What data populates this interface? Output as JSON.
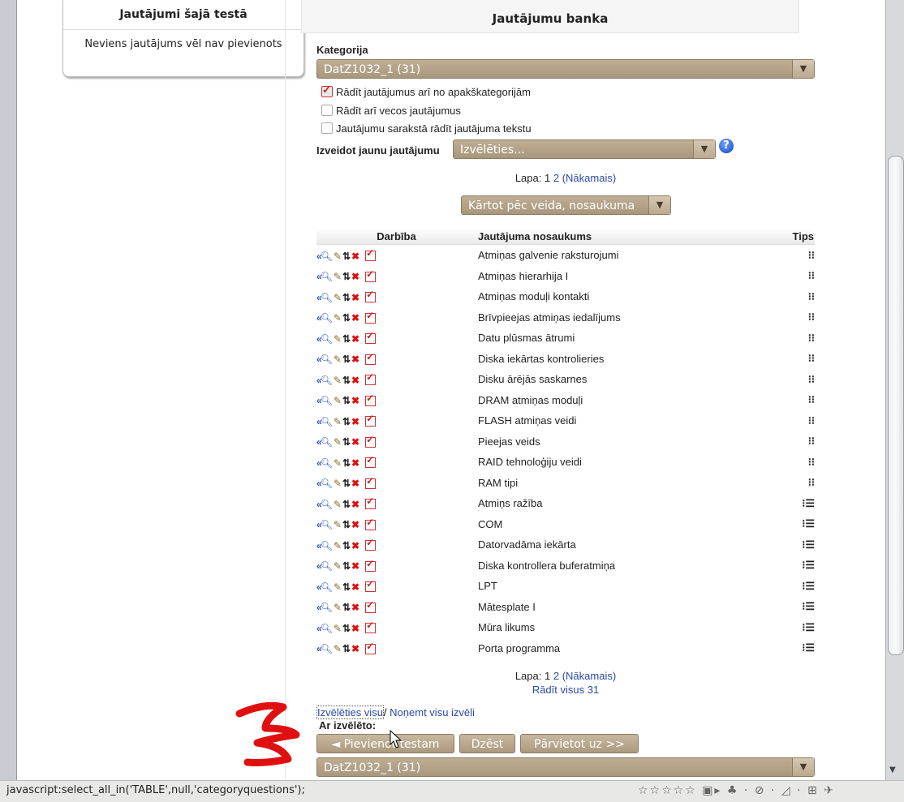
{
  "left_block": {
    "title": "Jautājumi šajā testā",
    "body": "Neviens jautājums vēl nav pievienots"
  },
  "bank": {
    "title": "Jautājumu banka",
    "category_label": "Kategorija",
    "category_value": "DatZ1032_1 (31)",
    "checkboxes": [
      {
        "label": "Rādīt jautājumus arī no apakškategorijām",
        "checked": true
      },
      {
        "label": "Rādīt arī vecos jautājumus",
        "checked": false
      },
      {
        "label": "Jautājumu sarakstā rādīt jautājuma tekstu",
        "checked": false
      }
    ],
    "create_label": "Izveidot jaunu jautājumu",
    "create_value": "Izvēlēties...",
    "pager_label": "Lapa:",
    "pager_p1": "1",
    "pager_p2": "2",
    "pager_next": "(Nākamais)",
    "sort_value": "Kārtot pēc veida, nosaukuma",
    "show_all": "Rādīt visus 31"
  },
  "table": {
    "headers": {
      "action": "Darbība",
      "name": "Jautājuma nosaukums",
      "type": "Tips"
    },
    "rows": [
      {
        "name": "Atmiņas galvenie raksturojumi",
        "type": "⁝⁝"
      },
      {
        "name": "Atmiņas hierarhija I",
        "type": "⁝⁝"
      },
      {
        "name": "Atmiņas moduļi kontakti",
        "type": "⁝⁝"
      },
      {
        "name": "Brīvpieejas atmiņas iedalījums",
        "type": "⁝⁝"
      },
      {
        "name": "Datu plūsmas ātrumi",
        "type": "⁝⁝"
      },
      {
        "name": "Diska iekārtas kontrolieries",
        "type": "⁝⁝"
      },
      {
        "name": "Disku ārējās saskarnes",
        "type": "⁝⁝"
      },
      {
        "name": "DRAM atmiņas moduļi",
        "type": "⁝⁝"
      },
      {
        "name": "FLASH atmiņas veidi",
        "type": "⁝⁝"
      },
      {
        "name": "Pieejas veids",
        "type": "⁝⁝"
      },
      {
        "name": "RAID tehnoloģiju veidi",
        "type": "⁝⁝"
      },
      {
        "name": "RAM tipi",
        "type": "⁝⁝"
      },
      {
        "name": "Atmiņs ražība",
        "type": "⁝☰"
      },
      {
        "name": "COM",
        "type": "⁝☰"
      },
      {
        "name": "Datorvadāma iekārta",
        "type": "⁝☰"
      },
      {
        "name": "Diska kontrollera buferatmiņa",
        "type": "⁝☰"
      },
      {
        "name": "LPT",
        "type": "⁝☰"
      },
      {
        "name": "Mātesplate I",
        "type": "⁝☰"
      },
      {
        "name": "Mūra likums",
        "type": "⁝☰"
      },
      {
        "name": "Porta programma",
        "type": "⁝☰"
      }
    ]
  },
  "bottom": {
    "select_all": "Izvēlēties visu",
    "sep": "/",
    "deselect_all": "Noņemt visu izvēli",
    "with_selected": "Ar izvēlēto:",
    "add_button": "◄ Pievienot testam",
    "delete_button": "Dzēst",
    "move_button": "Pārvietot uz >>",
    "move_target": "DatZ1032_1 (31)"
  },
  "status_bar": {
    "text": "javascript:select_all_in('TABLE',null,'categoryquestions');",
    "icons": "☆☆☆☆☆ ▣▸  ♣ · ⊘ · ◿ · ⊞ ✈"
  }
}
